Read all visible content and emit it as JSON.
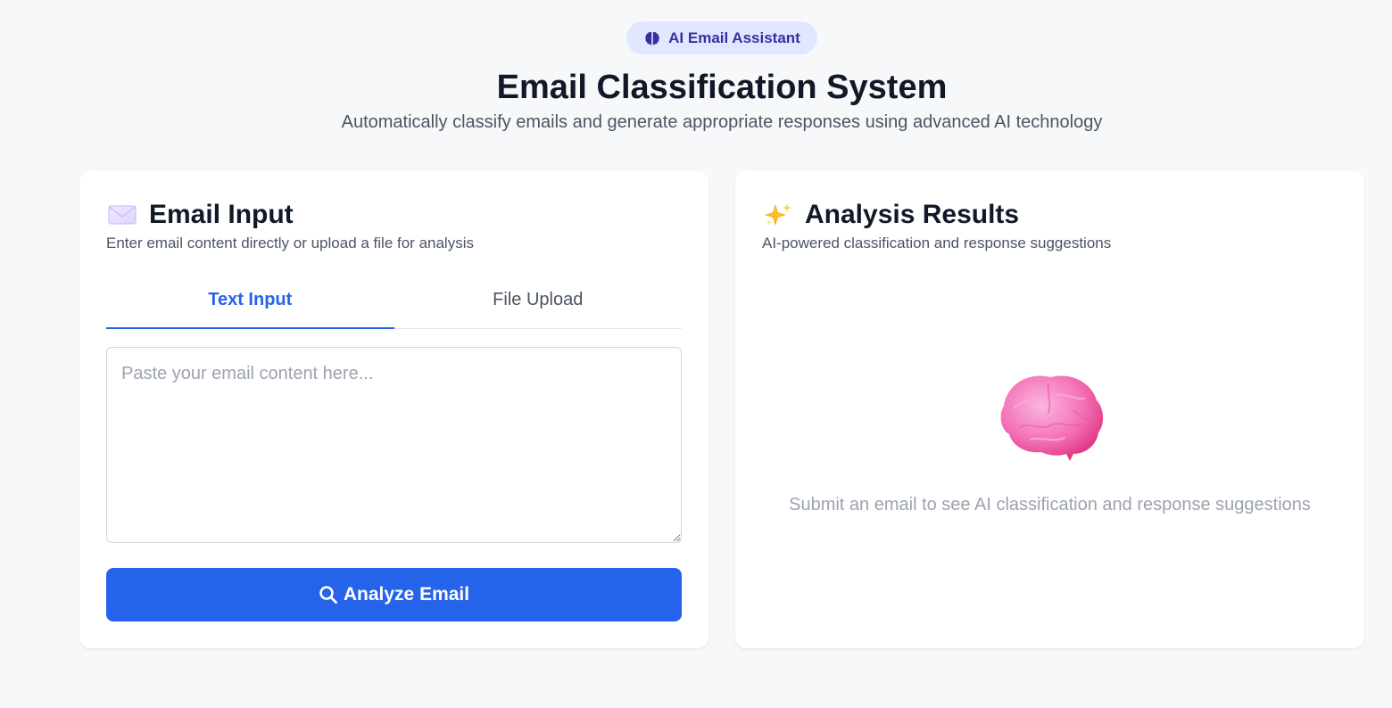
{
  "header": {
    "badge": {
      "icon": "brain-icon",
      "label": "AI Email Assistant"
    },
    "title": "Email Classification System",
    "subtitle": "Automatically classify emails and generate appropriate responses using advanced AI technology"
  },
  "input_panel": {
    "icon": "envelope-icon",
    "title": "Email Input",
    "description": "Enter email content directly or upload a file for analysis",
    "tabs": [
      {
        "label": "Text Input",
        "active": true
      },
      {
        "label": "File Upload",
        "active": false
      }
    ],
    "textarea": {
      "value": "",
      "placeholder": "Paste your email content here..."
    },
    "analyze_button": {
      "icon": "search-icon",
      "label": "Analyze Email"
    }
  },
  "results_panel": {
    "icon": "sparkles-icon",
    "title": "Analysis Results",
    "description": "AI-powered classification and response suggestions",
    "empty_state": {
      "icon": "brain-illustration",
      "text": "Submit an email to see AI classification and response suggestions"
    }
  },
  "colors": {
    "page_background": "#f7f8fa",
    "accent": "#2563eb",
    "badge_background": "#e0e7ff",
    "badge_text": "#3730a3",
    "brain": "#f472b6"
  }
}
